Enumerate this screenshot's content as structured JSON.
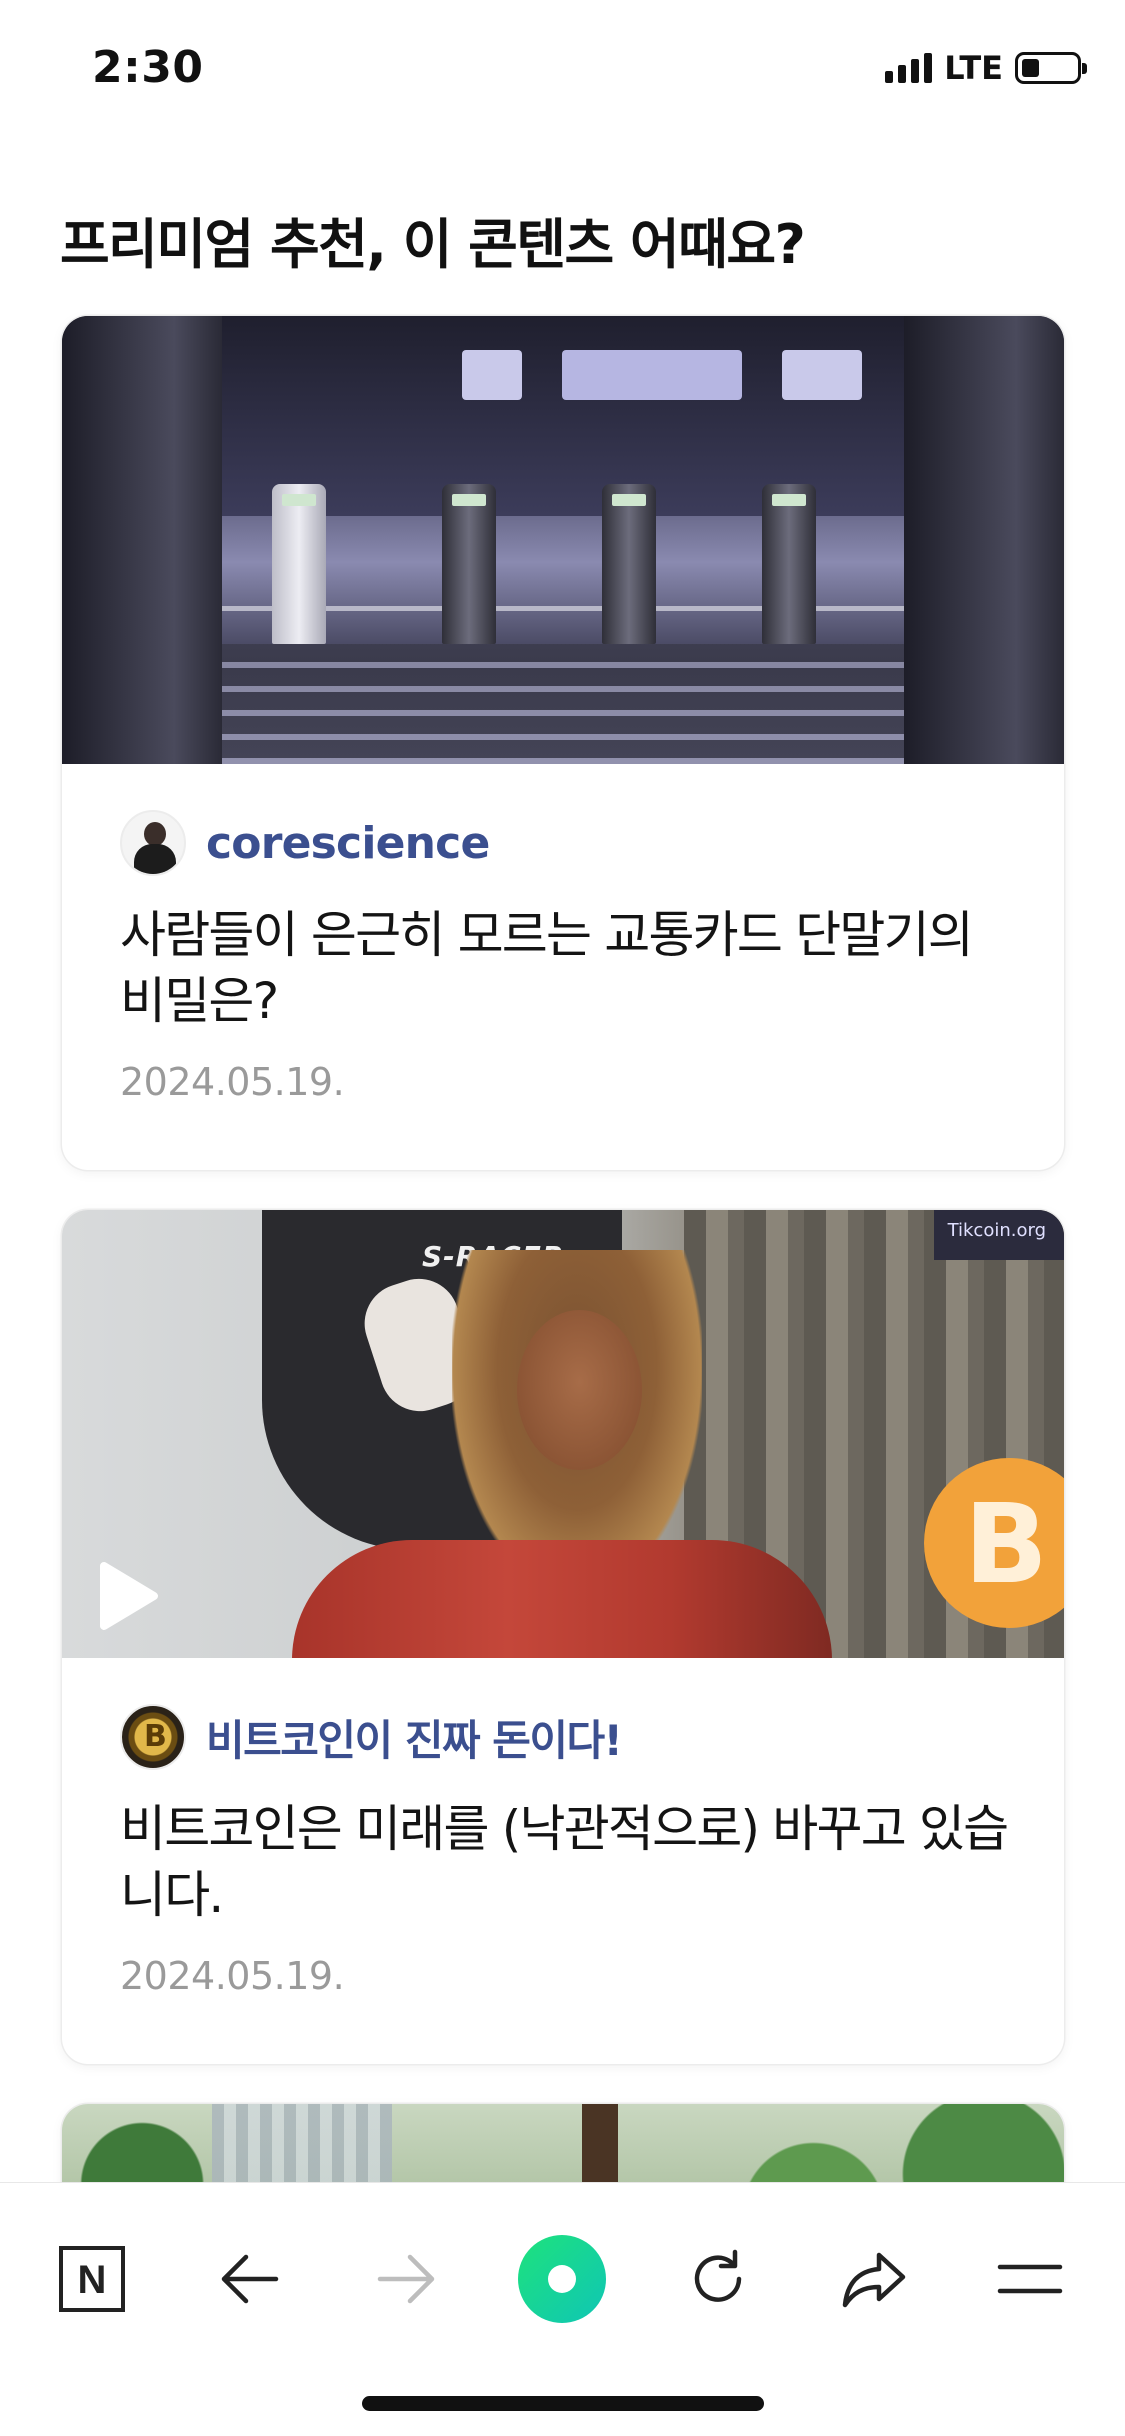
{
  "status_bar": {
    "time": "2:30",
    "network": "LTE",
    "battery_level": 0.3
  },
  "section": {
    "title": "프리미엄 추천, 이 콘텐츠 어때요?"
  },
  "cards": [
    {
      "author": "corescience",
      "title": "사람들이 은근히 모르는 교통카드 단말기의 비밀은?",
      "date": "2024.05.19.",
      "thumbnail": "subway-turnstiles-photo",
      "has_video": false
    },
    {
      "author": "비트코인이 진짜 돈이다!",
      "title": "비트코인은 미래를 (낙관적으로) 바꾸고 있습니다.",
      "date": "2024.05.19.",
      "thumbnail": "streamer-video-frame",
      "has_video": true,
      "overlay_text": "S-RACER",
      "brand_text": "Tikcoin.org",
      "coin_glyph": "B"
    },
    {
      "thumbnail": "trees-photo"
    }
  ],
  "toolbar": {
    "items": [
      {
        "icon": "naver-n-icon",
        "glyph": "N"
      },
      {
        "icon": "back-arrow-icon"
      },
      {
        "icon": "forward-arrow-icon",
        "disabled": true
      },
      {
        "icon": "green-dot-home-icon",
        "color": "#19d67a"
      },
      {
        "icon": "refresh-icon"
      },
      {
        "icon": "share-icon"
      },
      {
        "icon": "menu-icon"
      }
    ]
  },
  "colors": {
    "author_link": "#3b4f8f",
    "accent_green": "#19d67a",
    "date_gray": "#9a9a9a"
  }
}
